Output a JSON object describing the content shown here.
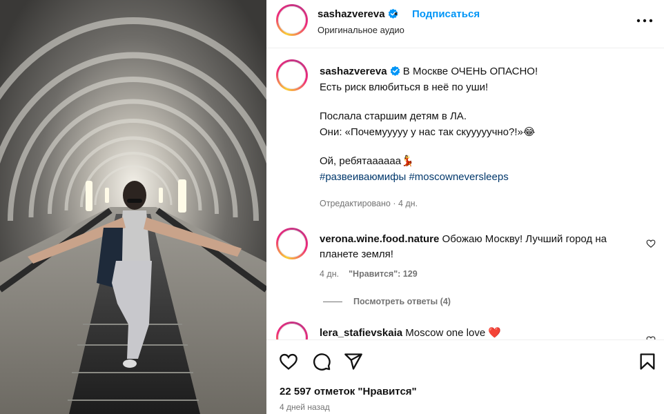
{
  "header": {
    "username": "sashazvereva",
    "separator": "•",
    "follow_label": "Подписаться",
    "audio": "Оригинальное аудио"
  },
  "caption": {
    "username": "sashazvereva",
    "lines": [
      "В Москве ОЧЕНЬ ОПАСНО!",
      "Есть риск влюбиться в неё по уши!",
      "Послала старшим детям в ЛА.",
      "Они: «Почемууууу у нас так скууууучно?!»😂",
      "Ой, ребятаааааа💃"
    ],
    "hashtags": [
      "#развеиваюмифы",
      "#moscowneversleeps"
    ],
    "edited": "Отредактировано · 4 дн."
  },
  "comments": [
    {
      "username": "verona.wine.food.nature",
      "text": "Обожаю Москву! Лучший город на планете земля!",
      "time": "4 дн.",
      "likes": "\"Нравится\": 129"
    },
    {
      "username": "lera_stafievskaia",
      "text": "Moscow one love ❤️"
    }
  ],
  "view_replies": "Посмотреть ответы (4)",
  "footer": {
    "likes": "22 597 отметок \"Нравится\"",
    "time": "4 дней назад"
  },
  "icons": [
    "verified-icon",
    "more-icon",
    "heart-icon",
    "comment-icon",
    "share-icon",
    "bookmark-icon"
  ],
  "colors": {
    "accent": "#0095f6",
    "hashtag": "#00376b",
    "secondary": "#737373",
    "heart": "#ff3040"
  }
}
